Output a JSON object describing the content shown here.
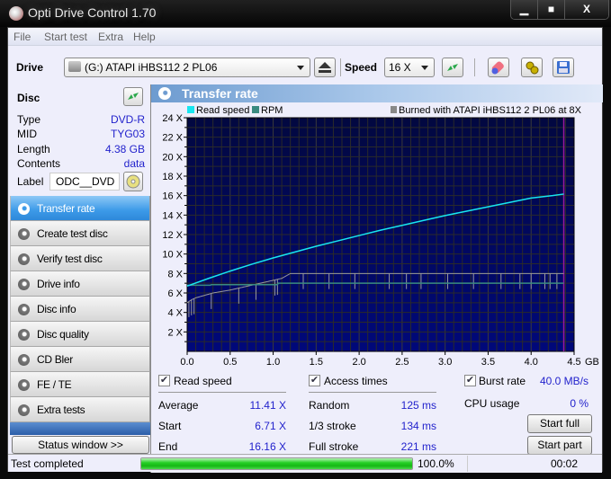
{
  "window": {
    "title": "Opti Drive Control 1.70",
    "minimize": "▁",
    "maximize": "■",
    "close": "X"
  },
  "menu": [
    "File",
    "Start test",
    "Extra",
    "Help"
  ],
  "toolbar": {
    "drive_label": "Drive",
    "drive_value": "(G:)   ATAPI iHBS112   2 PL06",
    "speed_label": "Speed",
    "speed_value": "16 X"
  },
  "disc": {
    "heading": "Disc",
    "rows": [
      {
        "key": "Type",
        "value": "DVD-R"
      },
      {
        "key": "MID",
        "value": "TYG03"
      },
      {
        "key": "Length",
        "value": "4.38 GB"
      },
      {
        "key": "Contents",
        "value": "data"
      }
    ],
    "label_key": "Label",
    "label_value": "ODC__DVD"
  },
  "nav": [
    {
      "label": "Transfer rate",
      "active": true
    },
    {
      "label": "Create test disc"
    },
    {
      "label": "Verify test disc"
    },
    {
      "label": "Drive info"
    },
    {
      "label": "Disc info"
    },
    {
      "label": "Disc quality"
    },
    {
      "label": "CD Bler"
    },
    {
      "label": "FE / TE"
    },
    {
      "label": "Extra tests"
    }
  ],
  "status_window_button": "Status window >>",
  "panel": {
    "title": "Transfer rate"
  },
  "chart_data": {
    "type": "line",
    "title": "Transfer rate",
    "legend": [
      {
        "name": "Read speed",
        "color": "#18e6f0"
      },
      {
        "name": "RPM",
        "color": "#3a8a80"
      }
    ],
    "burn_info": "Burned with ATAPI iHBS112   2 PL06 at 8X",
    "xlabel": "GB",
    "ylabel": "X",
    "xlim": [
      0,
      4.5
    ],
    "ylim": [
      0,
      24
    ],
    "x_ticks": [
      "0.0",
      "0.5",
      "1.0",
      "1.5",
      "2.0",
      "2.5",
      "3.0",
      "3.5",
      "4.0",
      "4.5"
    ],
    "y_ticks": [
      "2 X",
      "4 X",
      "6 X",
      "8 X",
      "10 X",
      "12 X",
      "14 X",
      "16 X",
      "18 X",
      "20 X",
      "22 X",
      "24 X"
    ],
    "grid": true,
    "end_marker_gb": 4.38,
    "series": [
      {
        "name": "Read speed",
        "x": [
          0,
          0.25,
          0.5,
          0.75,
          1.0,
          1.25,
          1.5,
          1.75,
          2.0,
          2.25,
          2.5,
          2.75,
          3.0,
          3.25,
          3.5,
          3.75,
          4.0,
          4.25,
          4.38
        ],
        "y": [
          6.71,
          7.5,
          8.25,
          8.95,
          9.6,
          10.2,
          10.8,
          11.35,
          11.9,
          12.45,
          12.95,
          13.45,
          13.95,
          14.4,
          14.85,
          15.3,
          15.75,
          16.0,
          16.16
        ]
      },
      {
        "name": "RPM",
        "x": [
          0,
          0.27,
          0.28,
          1.05,
          1.06,
          4.38
        ],
        "y": [
          6.8,
          6.8,
          6.85,
          6.85,
          7.0,
          7.0
        ]
      },
      {
        "name": "Burn speed",
        "x": [
          0,
          0.05,
          0.1,
          0.3,
          0.5,
          0.7,
          0.9,
          1.1,
          1.2,
          1.5,
          2.0,
          2.5,
          3.0,
          3.5,
          4.0,
          4.38
        ],
        "y": [
          5.0,
          5.3,
          5.5,
          6.0,
          6.3,
          6.7,
          7.1,
          7.5,
          8.0,
          8.0,
          8.0,
          8.0,
          8.0,
          8.0,
          8.0,
          8.0
        ],
        "dips_gb": [
          0.02,
          0.05,
          0.08,
          0.28,
          0.6,
          0.8,
          1.02,
          1.05,
          1.35,
          1.65,
          1.95,
          2.35,
          2.55,
          2.72,
          3.03,
          3.33,
          3.65,
          3.87,
          4.0,
          4.16,
          4.22,
          4.3
        ]
      }
    ]
  },
  "stats": {
    "read_speed": {
      "label": "Read speed",
      "checked": true,
      "rows": [
        {
          "key": "Average",
          "value": "11.41 X"
        },
        {
          "key": "Start",
          "value": "6.71 X"
        },
        {
          "key": "End",
          "value": "16.16 X"
        }
      ]
    },
    "access_times": {
      "label": "Access times",
      "checked": true,
      "rows": [
        {
          "key": "Random",
          "value": "125 ms"
        },
        {
          "key": "1/3 stroke",
          "value": "134 ms"
        },
        {
          "key": "Full stroke",
          "value": "221 ms"
        }
      ]
    },
    "burst_rate": {
      "label": "Burst rate",
      "checked": true,
      "value": "40.0 MB/s"
    },
    "cpu_usage": {
      "label": "CPU usage",
      "value": "0 %"
    },
    "start_full": "Start full",
    "start_part": "Start part"
  },
  "statusbar": {
    "text": "Test completed",
    "progress_percent": 100,
    "progress_text": "100.0%",
    "elapsed": "00:02"
  }
}
